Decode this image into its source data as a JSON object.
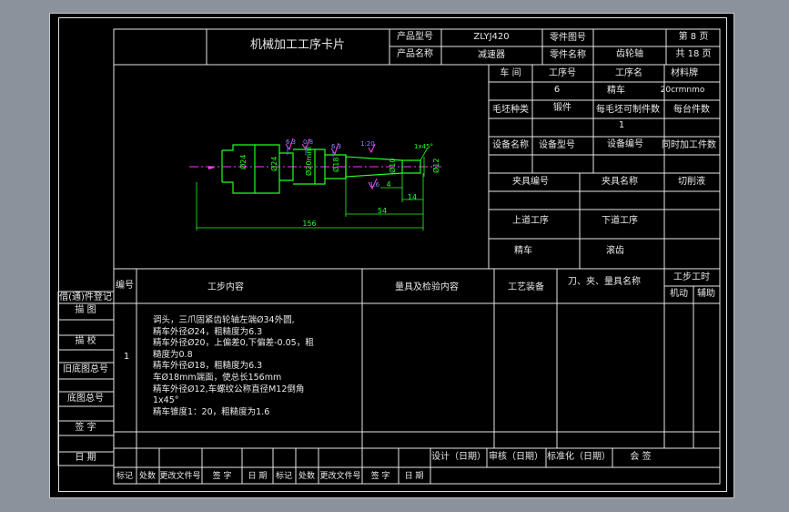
{
  "header": {
    "title": "机械加工工序卡片",
    "product_model_label": "产品型号",
    "product_model_value": "ZLYJ420",
    "part_drawing_label": "零件图号",
    "page_label": "第 8 页",
    "product_name_label": "产品名称",
    "product_name_value": "减速器",
    "part_name_label": "零件名称",
    "part_name_value": "齿轮轴",
    "total_pages_label": "共 18 页"
  },
  "process_info": {
    "workshop_label": "车 间",
    "op_no_label": "工序号",
    "op_no_value": "6",
    "op_name_label": "工序名",
    "op_name_value": "精车",
    "material_label": "材料牌",
    "material_value": "20crmnmo",
    "blank_type_label": "毛坯种类",
    "blank_type_value": "锻件",
    "per_blank_label": "每毛坯可制件数",
    "per_blank_value": "1",
    "per_unit_label": "每台件数",
    "equip_name_label": "设备名称",
    "equip_model_label": "设备型号",
    "equip_no_label": "设备编号",
    "simul_label": "同时加工件数",
    "fixture_no_label": "夹具编号",
    "fixture_name_label": "夹具名称",
    "coolant_label": "切削液",
    "prev_op_label": "上道工序",
    "next_op_label": "下道工序",
    "prev_op_value": "精车",
    "next_op_value": "滚齿"
  },
  "drawing": {
    "dims": {
      "d24a": "Ø24",
      "d24b": "Ø24",
      "d20": "Ø20mm",
      "d18": "Ø18",
      "d10": "Ø10",
      "d12": "Ø12",
      "len156": "156",
      "len54": "54",
      "len14": "14",
      "len4": "4",
      "chamfer": "1x45°",
      "ra1": "6.3",
      "ra2": "0.8",
      "ra3": "6.3",
      "ra4": "1:20",
      "ra5": "1.6"
    }
  },
  "table": {
    "col_step_no": "编号",
    "col_content": "工步内容",
    "col_gauge": "量具及检验内容",
    "col_equip": "工艺装备",
    "col_tools": "刀、夹、量具名称",
    "col_time": "工步工时",
    "col_time_machine": "机动",
    "col_time_aux": "辅助",
    "row_no": "1",
    "row_content_lines": [
      "调头，三爪固紧齿轮轴左端Ø34外圆,",
      "精车外径Ø24，粗糙度为6.3",
      "精车外径Ø20，上偏差0,下偏差-0.05，粗",
      "糙度为0.8",
      "精车外径Ø18，粗糙度为6.3",
      "车Ø18mm端面，使总长156mm",
      "精车外径Ø12,车螺纹公称直径M12倒角",
      "1x45°",
      "精车锥度1：20，粗糙度为1.6"
    ]
  },
  "left_strip": {
    "items": [
      "借(通)件登记",
      "描    图",
      "描    校",
      "旧底图总号",
      "底图总号",
      "签    字",
      "日    期"
    ]
  },
  "footer": {
    "design": "设计（日期）",
    "review": "审核（日期）",
    "standard": "标准化（日期）",
    "countersign": "会    签",
    "cells": [
      "标记",
      "处数",
      "更改文件号",
      "签 字",
      "日 期",
      "标记",
      "处数",
      "更改文件号",
      "签 字",
      "日 期"
    ]
  }
}
